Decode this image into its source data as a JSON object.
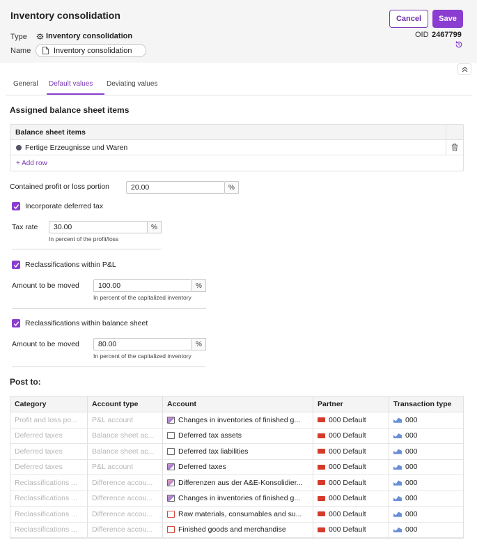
{
  "header": {
    "title": "Inventory consolidation",
    "type_label": "Type",
    "type_value": "Inventory consolidation",
    "name_label": "Name",
    "name_value": "Inventory consolidation",
    "cancel_label": "Cancel",
    "save_label": "Save",
    "oid_label": "OID",
    "oid_value": "2467799"
  },
  "tabs": [
    {
      "label": "General"
    },
    {
      "label": "Default values",
      "active": true
    },
    {
      "label": "Deviating values"
    }
  ],
  "assigned": {
    "title": "Assigned balance sheet items",
    "column": "Balance sheet items",
    "rows": [
      "Fertige Erzeugnisse und Waren"
    ],
    "add_row": "+ Add row"
  },
  "profit_loss": {
    "label": "Contained profit or loss portion",
    "value": "20.00",
    "unit": "%"
  },
  "deferred_tax": {
    "label": "Incorporate deferred tax",
    "checked": true,
    "tax_rate_label": "Tax rate",
    "tax_rate_value": "30.00",
    "unit": "%",
    "hint": "In percent of the profit/loss"
  },
  "reclass_pl": {
    "label": "Reclassifications within P&L",
    "checked": true,
    "amount_label": "Amount to be moved",
    "amount_value": "100.00",
    "unit": "%",
    "hint": "In percent of the capitalized inventory"
  },
  "reclass_bs": {
    "label": "Reclassifications within balance sheet",
    "checked": true,
    "amount_label": "Amount to be moved",
    "amount_value": "80.00",
    "unit": "%",
    "hint": "In percent of the capitalized inventory"
  },
  "post_to": {
    "title": "Post to:",
    "columns": [
      "Category",
      "Account type",
      "Account",
      "Partner",
      "Transaction type"
    ],
    "rows": [
      {
        "category": "Profit and loss po...",
        "account_type": "P&L account",
        "account": "Changes in inventories of finished g...",
        "account_icon": "pl",
        "partner": "000 Default",
        "transaction_type": "000"
      },
      {
        "category": "Deferred taxes",
        "account_type": "Balance sheet ac...",
        "account": "Deferred tax assets",
        "account_icon": "bs",
        "partner": "000 Default",
        "transaction_type": "000"
      },
      {
        "category": "Deferred taxes",
        "account_type": "Balance sheet ac...",
        "account": "Deferred tax liabilities",
        "account_icon": "bs",
        "partner": "000 Default",
        "transaction_type": "000"
      },
      {
        "category": "Deferred taxes",
        "account_type": "P&L account",
        "account": "Deferred taxes",
        "account_icon": "pl",
        "partner": "000 Default",
        "transaction_type": "000"
      },
      {
        "category": "Reclassifications ...",
        "account_type": "Difference accou...",
        "account": "Differenzen aus der A&E-Konsolidier...",
        "account_icon": "diff",
        "partner": "000 Default",
        "transaction_type": "000"
      },
      {
        "category": "Reclassifications ...",
        "account_type": "Difference accou...",
        "account": "Changes in inventories of finished g...",
        "account_icon": "pl",
        "partner": "000 Default",
        "transaction_type": "000"
      },
      {
        "category": "Reclassifications ...",
        "account_type": "Difference accou...",
        "account": "Raw materials, consumables and su...",
        "account_icon": "raw",
        "partner": "000 Default",
        "transaction_type": "000"
      },
      {
        "category": "Reclassifications ...",
        "account_type": "Difference accou...",
        "account": "Finished goods and merchandise",
        "account_icon": "raw",
        "partner": "000 Default",
        "transaction_type": "000"
      }
    ]
  },
  "colors": {
    "accent": "#8a3dd0",
    "muted_text": "#b6b6b6",
    "flag": "#d63a2b",
    "transaction_icon": "#6a8fd8"
  }
}
